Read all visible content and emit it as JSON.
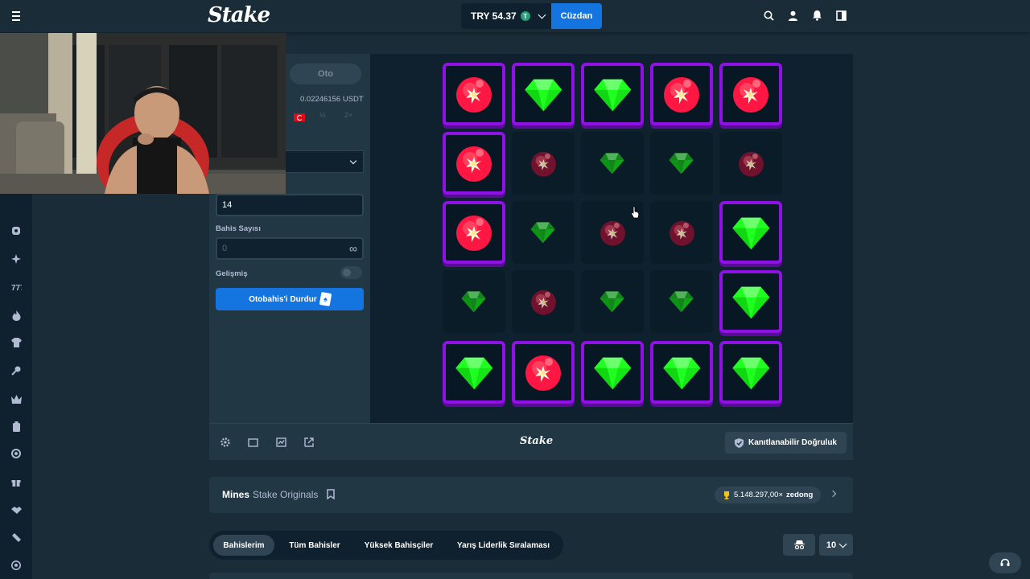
{
  "header": {
    "logo": "Stake",
    "balance": "TRY 54.37",
    "currency_icon": "T",
    "wallet_label": "Cüzdan",
    "icons": [
      "search-icon",
      "user-icon",
      "bell-icon",
      "sidebar-icon"
    ]
  },
  "panel": {
    "mode_label": "Oto",
    "usdt_value": "0.02246156 USDT",
    "half_label": "½",
    "double_label": "2×",
    "mines_value": "14",
    "bet_count_label": "Bahis Sayısı",
    "bet_count_placeholder": "0",
    "infinity": "∞",
    "advanced_label": "Gelişmiş",
    "stop_label": "Otobahis'i Durdur"
  },
  "board": {
    "grid": [
      [
        "mine",
        "gem",
        "gem",
        "mine",
        "mine"
      ],
      [
        "mine",
        "hidden-mine",
        "hidden-gem",
        "hidden-gem",
        "hidden-mine"
      ],
      [
        "mine",
        "hidden-gem",
        "hidden-mine",
        "hidden-mine",
        "gem"
      ],
      [
        "hidden-gem",
        "hidden-mine",
        "hidden-gem",
        "hidden-gem",
        "gem"
      ],
      [
        "gem",
        "mine",
        "gem",
        "gem",
        "gem"
      ]
    ],
    "colors": {
      "gem": "#1fff20",
      "mine": "#ff1744",
      "border": "#8f11e6"
    }
  },
  "footer": {
    "logo": "Stake",
    "fair_label": "Kanıtlanabilir Doğruluk"
  },
  "game_info": {
    "name": "Mines",
    "subtitle": "Stake Originals",
    "record": "5.148.297,00×",
    "record_user": "zedong"
  },
  "bets": {
    "tabs": [
      "Bahislerim",
      "Tüm Bahisler",
      "Yüksek Bahisçiler",
      "Yarış Liderlik Sıralaması"
    ],
    "active_tab": 0,
    "count": "10"
  }
}
